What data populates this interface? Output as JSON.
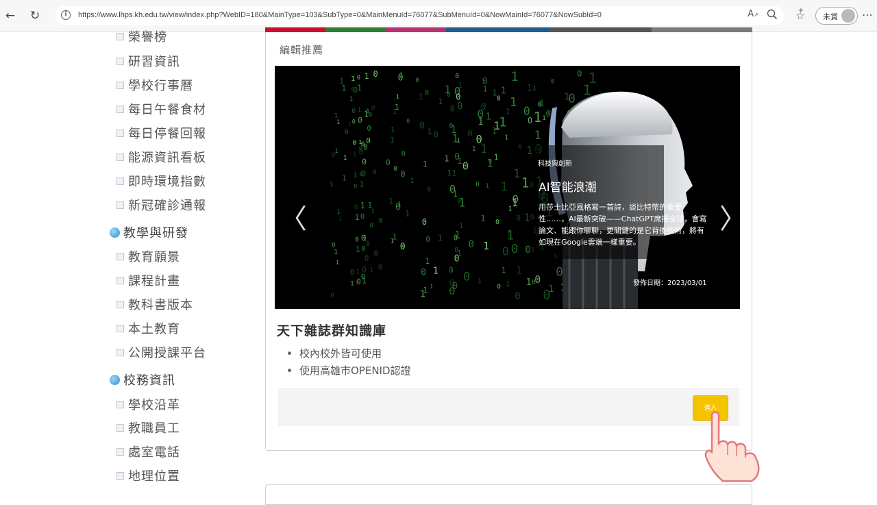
{
  "browser": {
    "url": "https://www.lhps.kh.edu.tw/view/index.php?WebID=180&MainType=103&SubType=0&MainMenuId=76077&SubMenuId=0&NowMainId=76077&NowSubId=0",
    "profile_label": "未賞",
    "reader_label": "A",
    "icons": [
      "back-icon",
      "refresh-icon",
      "info-icon",
      "read-aloud-icon",
      "zoom-icon",
      "favorites-icon",
      "collections-icon",
      "avatar-icon",
      "more-icon"
    ]
  },
  "sidebar": {
    "items_top": [
      "榮譽榜",
      "研習資訊",
      "學校行事曆",
      "每日午餐食材",
      "每日停餐回報",
      "能源資訊看板",
      "即時環境指數",
      "新冠確診通報"
    ],
    "category_1": "教學與研發",
    "items_mid": [
      "教育願景",
      "課程計畫",
      "教科書版本",
      "本土教育",
      "公開授課平台"
    ],
    "category_2": "校務資訊",
    "items_bottom": [
      "學校沿革",
      "教職員工",
      "處室電話",
      "地理位置"
    ]
  },
  "panel": {
    "title": "編輯推薦",
    "color_bar": [
      "#c8102e",
      "#2e7d32",
      "#b8326f",
      "#1f5e8a",
      "#555555",
      "#7a7a7a"
    ]
  },
  "carousel": {
    "tag": "科技與創新",
    "title": "AI智能浪潮",
    "body": "用莎士比亞風格寫一首詩，談比特幣的重要性……，AI最新突破——ChatGPT席捲全球，會寫論文、能跟你聊聊，更關鍵的是它背後技術，將有如現在Google雲端一樣重要。",
    "date": "發佈日期：2023/03/01",
    "prev": "〈",
    "next": "〉"
  },
  "section": {
    "title": "天下雜誌群知識庫",
    "bullets": [
      "校內校外皆可使用",
      "使用高雄市OPENID認證"
    ],
    "enter_label": "進入"
  }
}
